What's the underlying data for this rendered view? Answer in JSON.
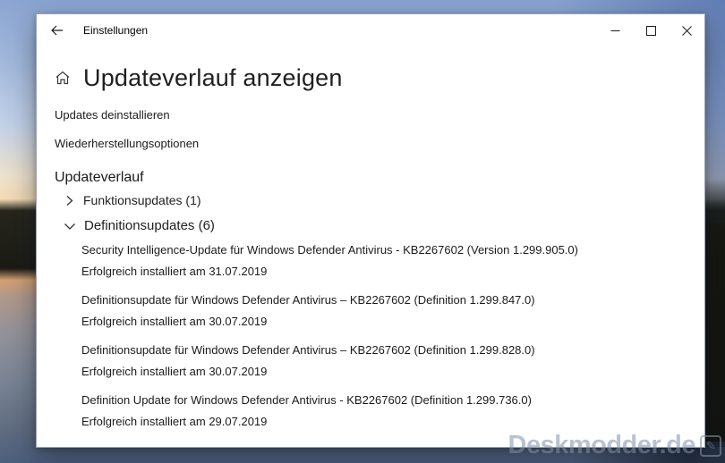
{
  "window": {
    "title": "Einstellungen",
    "page": {
      "title": "Updateverlauf anzeigen",
      "links": [
        {
          "label": "Updates deinstallieren"
        },
        {
          "label": "Wiederherstellungsoptionen"
        }
      ],
      "history": {
        "heading": "Updateverlauf",
        "groups": [
          {
            "label": "Funktionsupdates (1)",
            "expanded": false
          },
          {
            "label": "Definitionsupdates (6)",
            "expanded": true
          }
        ],
        "updates": [
          {
            "title": "Security Intelligence-Update für Windows Defender Antivirus - KB2267602 (Version 1.299.905.0)",
            "status": "Erfolgreich installiert am 31.07.2019"
          },
          {
            "title": "Definitionsupdate für Windows Defender Antivirus – KB2267602 (Definition 1.299.847.0)",
            "status": "Erfolgreich installiert am 30.07.2019"
          },
          {
            "title": "Definitionsupdate für Windows Defender Antivirus – KB2267602 (Definition 1.299.828.0)",
            "status": "Erfolgreich installiert am 30.07.2019"
          },
          {
            "title": "Definition Update for Windows Defender Antivirus - KB2267602 (Definition 1.299.736.0)",
            "status": "Erfolgreich installiert am 29.07.2019"
          }
        ]
      }
    }
  },
  "watermark": {
    "text": "Deskmodder.de"
  },
  "icons": {
    "back": "arrow-left",
    "home": "home",
    "minimize": "dash",
    "maximize": "square",
    "close": "x",
    "collapsed_group": "chevron-right",
    "expanded_group": "chevron-down",
    "watermark_badge": "pencil"
  },
  "colors": {
    "window_bg": "#ffffff",
    "text": "#1b1b1b",
    "sky": "#8aa5d2",
    "sunset": "#f3dcb6",
    "water_bottom": "#4d5f7f"
  }
}
